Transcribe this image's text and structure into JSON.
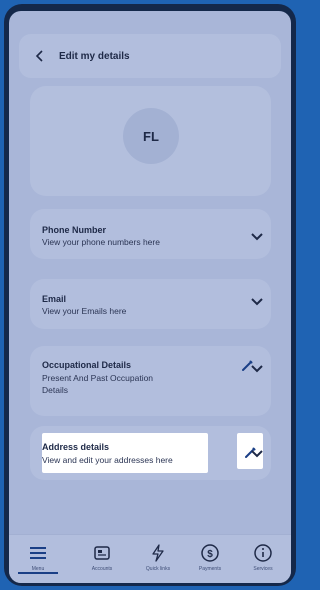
{
  "header": {
    "title": "Edit my details"
  },
  "profile": {
    "initials": "FL"
  },
  "cards": [
    {
      "title": "Phone Number",
      "subtitle": "View your phone numbers here"
    },
    {
      "title": "Email",
      "subtitle": "View your Emails here"
    },
    {
      "title": "Occupational Details",
      "subtitle_line1": "Present And Past Occupation",
      "subtitle_line2": "Details"
    },
    {
      "title": "Address details",
      "subtitle": "View and edit your addresses here"
    }
  ],
  "nav": {
    "items": [
      {
        "label": "Menu",
        "icon": "menu-icon"
      },
      {
        "label": "Accounts",
        "icon": "accounts-icon"
      },
      {
        "label": "Quick links",
        "icon": "quick-links-icon"
      },
      {
        "label": "Payments",
        "icon": "payments-icon"
      },
      {
        "label": "Services",
        "icon": "services-icon"
      }
    ]
  },
  "colors": {
    "accent": "#1a3f86",
    "screen_bg": "#a9b6d8",
    "card_bg": "#b2bedd"
  }
}
